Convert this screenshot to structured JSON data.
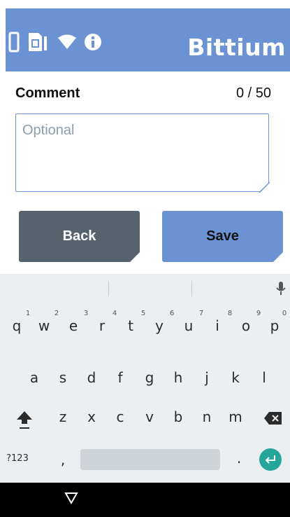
{
  "header": {
    "brand": "Bittium",
    "icons": [
      "phone-icon",
      "sim-card-icon",
      "wifi-icon",
      "info-icon"
    ],
    "color": "#6b93d4"
  },
  "comment": {
    "label": "Comment",
    "counter": "0 / 50",
    "placeholder": "Optional"
  },
  "buttons": {
    "back": "Back",
    "save": "Save"
  },
  "keyboard": {
    "row1": [
      "q",
      "w",
      "e",
      "r",
      "t",
      "y",
      "u",
      "i",
      "o",
      "p"
    ],
    "row1_hints": [
      "1",
      "2",
      "3",
      "4",
      "5",
      "6",
      "7",
      "8",
      "9",
      "0"
    ],
    "row2": [
      "a",
      "s",
      "d",
      "f",
      "g",
      "h",
      "j",
      "k",
      "l"
    ],
    "row3": [
      "z",
      "x",
      "c",
      "v",
      "b",
      "n",
      "m"
    ],
    "symbols_key": "?123",
    "comma": ",",
    "period": ".",
    "enter_color": "#26a69a"
  }
}
